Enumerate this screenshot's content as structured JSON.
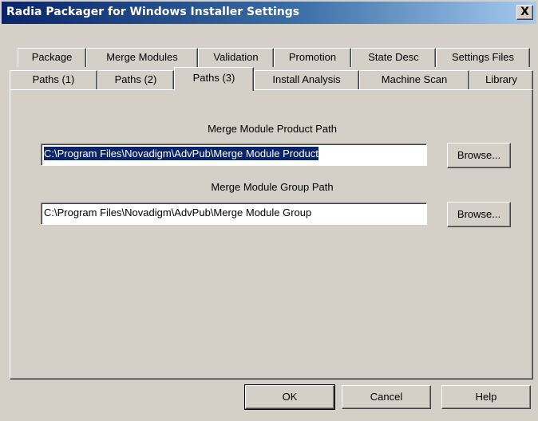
{
  "window": {
    "title": "Radia Packager for Windows Installer Settings",
    "close_label": "X"
  },
  "tabs": {
    "row1": [
      "Package",
      "Merge Modules",
      "Validation",
      "Promotion",
      "State Desc",
      "Settings Files"
    ],
    "row2": [
      "Paths (1)",
      "Paths (2)",
      "Paths (3)",
      "Install Analysis",
      "Machine Scan",
      "Library"
    ],
    "selected": "Paths (3)"
  },
  "content": {
    "product_path": {
      "label": "Merge Module Product Path",
      "value": "C:\\Program Files\\Novadigm\\AdvPub\\Merge Module Product",
      "browse_label": "Browse..."
    },
    "group_path": {
      "label": "Merge Module Group Path",
      "value": "C:\\Program Files\\Novadigm\\AdvPub\\Merge Module Group",
      "browse_label": "Browse..."
    }
  },
  "footer": {
    "ok_label": "OK",
    "cancel_label": "Cancel",
    "help_label": "Help"
  }
}
